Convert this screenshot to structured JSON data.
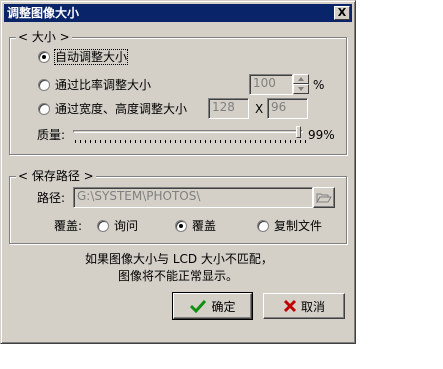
{
  "window": {
    "title": "调整图像大小",
    "close_glyph": "X"
  },
  "size_group": {
    "legend": "< 大小 >",
    "options": [
      {
        "label": "自动调整大小",
        "checked": true
      },
      {
        "label": "通过比率调整大小",
        "checked": false
      },
      {
        "label": "通过宽度、高度调整大小",
        "checked": false
      }
    ],
    "ratio_value": "100",
    "ratio_unit": "%",
    "width_value": "128",
    "height_value": "96",
    "times_sign": "X",
    "quality_label": "质量:",
    "quality_value": "99%",
    "quality_fraction": 0.99
  },
  "path_group": {
    "legend": "< 保存路径 >",
    "path_label": "路径:",
    "path_value": "G:\\SYSTEM\\PHOTOS\\",
    "overwrite_label": "覆盖:",
    "overwrite_options": [
      {
        "label": "询问",
        "checked": false
      },
      {
        "label": "覆盖",
        "checked": true
      },
      {
        "label": "复制文件",
        "checked": false
      }
    ]
  },
  "notice": {
    "line1": "如果图像大小与 LCD 大小不匹配，",
    "line2": "图像将不能正常显示。"
  },
  "buttons": {
    "ok": "确定",
    "cancel": "取消"
  },
  "colors": {
    "titlebar": "#0a246a",
    "ok_check": "#109010",
    "cancel_x": "#c00000"
  }
}
